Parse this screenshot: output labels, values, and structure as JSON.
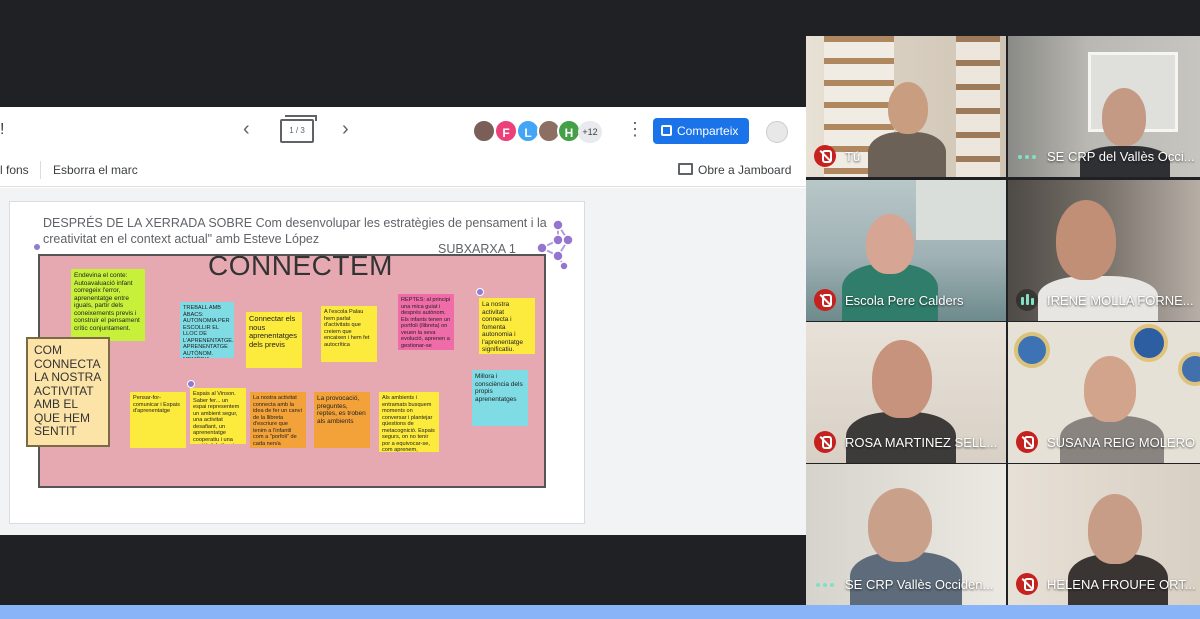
{
  "jamboard": {
    "title_fragment": "!",
    "frame_indicator": "1 / 3",
    "nav_prev": "‹",
    "nav_next": "›",
    "avatars": [
      "",
      "F",
      "L",
      "",
      "H"
    ],
    "more_count": "+12",
    "share_label": "Comparteix",
    "toolbar": {
      "background_fragment": "l fons",
      "clear_frame": "Esborra el marc",
      "open_in_jamboard": "Obre a Jamboard"
    },
    "frame": {
      "header": "DESPRÉS DE LA XERRADA SOBRE Com desenvolupar les estratègies de pensament i la creativitat en el context actual\"  amb Esteve López",
      "subnetwork": "SUBXARXA 1",
      "board_title": "CONNECTEM",
      "side_box": "COM CONNECTA LA NOSTRA ACTIVITAT AMB EL QUE HEM SENTIT",
      "notes": [
        "Endevina el conte: Autoavaluació infant corregeix l'error, aprenentatge entre iguals, partir dels coneixements previs i construir el pensament crític conjuntament.",
        "TREBALL AMB ÀBACS: AUTONOMIA PER ESCOLLIR EL LLOC DE L'APRENENTATGE. APRENENTATGE AUTÒNOM. MEMÒRIA VISUAL. DESMANTELACIÓ DE LA NUMERACIÓ I EL CÀLCUL MENTAL. CONCENTRACIÓ.",
        "Connectar els nous aprenentatges dels previs",
        "A l'escola Palau hem parlat d'activitats que creiem que encaixen i hem fet autocrítica",
        "REPTES: al principi una mica guiat i després autònom. Els infants tenen un portfoli (llibreta) on veuen la seva evolució, aprenen a gestionar-se",
        "La nostra activitat connecta i fomenta autonomia i l'aprenentatge significatiu.",
        "Pensar-for-comunicar i Espais d'aprenentatge",
        "Espais al Vinson. Saber fer... un espai representem un ambient segur, una activitat desafiant, un aprenentatge cooperatiu i una gestió del silenci que considerem acompanyar el procés convidant a participar",
        "La nostra activitat connecta amb la idea de fer un canvi de la llibreta d'escriure que tenim a l'infantil com a \"porfoli\" de cada nen/a",
        "La provocació, preguntes, reptes, es troben als ambients",
        "Als ambients i entramats busquem moments on conversar i plantejar qüestions de metacognició. Espais segurs, on no tenir por a equivocar-se, com aprenem, decidim...",
        "Millora i consciència dels propis aprenentatges"
      ]
    }
  },
  "participants": [
    {
      "name": "Tú",
      "status": "muted"
    },
    {
      "name": "SE CRP del Vallès Occi...",
      "status": "presenting"
    },
    {
      "name": "Escola Pere Calders",
      "status": "muted"
    },
    {
      "name": "IRENE MOLLA FORNE...",
      "status": "speaking"
    },
    {
      "name": "ROSA MARTINEZ SELL...",
      "status": "muted"
    },
    {
      "name": "SUSANA REIG MOLERO",
      "status": "muted"
    },
    {
      "name": "SE CRP Vallès Occiden...",
      "status": "presenting"
    },
    {
      "name": "HELENA FROUFE ORT...",
      "status": "muted"
    }
  ],
  "colors": {
    "share_button": "#1a73e8",
    "board_pink": "#e7a9b1",
    "mute_red": "#c5221f",
    "bottom_bar": "#8ab4f8"
  }
}
